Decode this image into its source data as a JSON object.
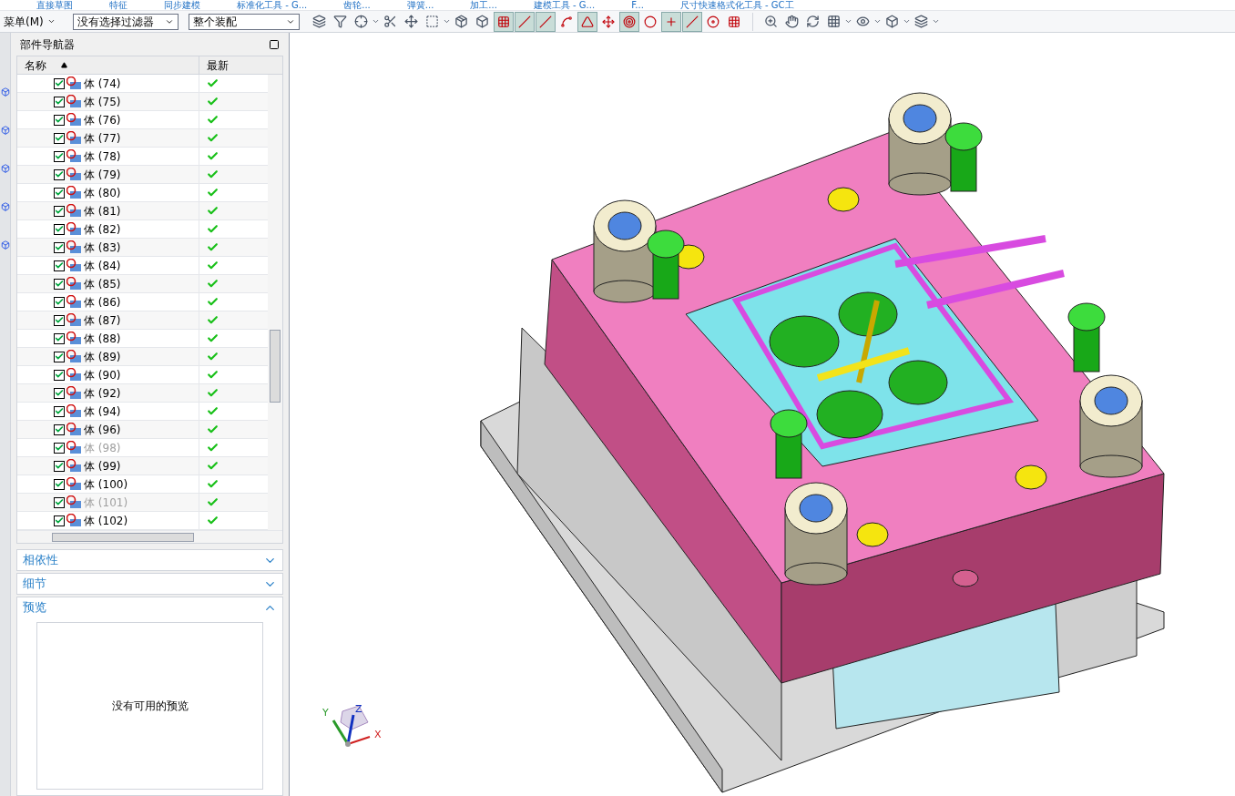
{
  "ribbon_groups": [
    "直接草图",
    "特征",
    "同步建模",
    "标准化工具 - G...",
    "齿轮...",
    "弹簧...",
    "加工...",
    "建模工具 - G...",
    "F...",
    "尺寸快速格式化工具 - GC工"
  ],
  "toolbar": {
    "menu": "菜单(M)",
    "selection_filter": "没有选择过滤器",
    "scope": "整个装配",
    "snap_tools": [
      {
        "pressed": true
      },
      {
        "pressed": true
      },
      {
        "pressed": true
      },
      {
        "pressed": false
      },
      {
        "pressed": true
      },
      {
        "pressed": false
      },
      {
        "pressed": true
      },
      {
        "pressed": false
      },
      {
        "pressed": true
      },
      {
        "pressed": true
      },
      {
        "pressed": false
      },
      {
        "pressed": false
      }
    ]
  },
  "navigator": {
    "title": "部件导航器",
    "columns": [
      "名称",
      "最新"
    ],
    "rows": [
      {
        "label": "体 (74)",
        "checked": true,
        "dimmed": false,
        "up_to_date": true
      },
      {
        "label": "体 (75)",
        "checked": true,
        "dimmed": false,
        "up_to_date": true
      },
      {
        "label": "体 (76)",
        "checked": true,
        "dimmed": false,
        "up_to_date": true
      },
      {
        "label": "体 (77)",
        "checked": true,
        "dimmed": false,
        "up_to_date": true
      },
      {
        "label": "体 (78)",
        "checked": true,
        "dimmed": false,
        "up_to_date": true
      },
      {
        "label": "体 (79)",
        "checked": true,
        "dimmed": false,
        "up_to_date": true
      },
      {
        "label": "体 (80)",
        "checked": true,
        "dimmed": false,
        "up_to_date": true
      },
      {
        "label": "体 (81)",
        "checked": true,
        "dimmed": false,
        "up_to_date": true
      },
      {
        "label": "体 (82)",
        "checked": true,
        "dimmed": false,
        "up_to_date": true
      },
      {
        "label": "体 (83)",
        "checked": true,
        "dimmed": false,
        "up_to_date": true
      },
      {
        "label": "体 (84)",
        "checked": true,
        "dimmed": false,
        "up_to_date": true
      },
      {
        "label": "体 (85)",
        "checked": true,
        "dimmed": false,
        "up_to_date": true
      },
      {
        "label": "体 (86)",
        "checked": true,
        "dimmed": false,
        "up_to_date": true
      },
      {
        "label": "体 (87)",
        "checked": true,
        "dimmed": false,
        "up_to_date": true
      },
      {
        "label": "体 (88)",
        "checked": true,
        "dimmed": false,
        "up_to_date": true
      },
      {
        "label": "体 (89)",
        "checked": true,
        "dimmed": false,
        "up_to_date": true
      },
      {
        "label": "体 (90)",
        "checked": true,
        "dimmed": false,
        "up_to_date": true
      },
      {
        "label": "体 (92)",
        "checked": true,
        "dimmed": false,
        "up_to_date": true
      },
      {
        "label": "体 (94)",
        "checked": true,
        "dimmed": false,
        "up_to_date": true
      },
      {
        "label": "体 (96)",
        "checked": true,
        "dimmed": false,
        "up_to_date": true
      },
      {
        "label": "体 (98)",
        "checked": true,
        "dimmed": true,
        "up_to_date": true
      },
      {
        "label": "体 (99)",
        "checked": true,
        "dimmed": false,
        "up_to_date": true
      },
      {
        "label": "体 (100)",
        "checked": true,
        "dimmed": false,
        "up_to_date": true
      },
      {
        "label": "体 (101)",
        "checked": true,
        "dimmed": true,
        "up_to_date": true
      },
      {
        "label": "体 (102)",
        "checked": true,
        "dimmed": false,
        "up_to_date": true
      }
    ],
    "sections": [
      {
        "title": "相依性",
        "expanded": false
      },
      {
        "title": "细节",
        "expanded": false
      },
      {
        "title": "预览",
        "expanded": true,
        "message": "没有可用的预览"
      }
    ]
  },
  "viewport": {
    "triad": {
      "x": "X",
      "y": "Y",
      "z": "Z"
    }
  }
}
